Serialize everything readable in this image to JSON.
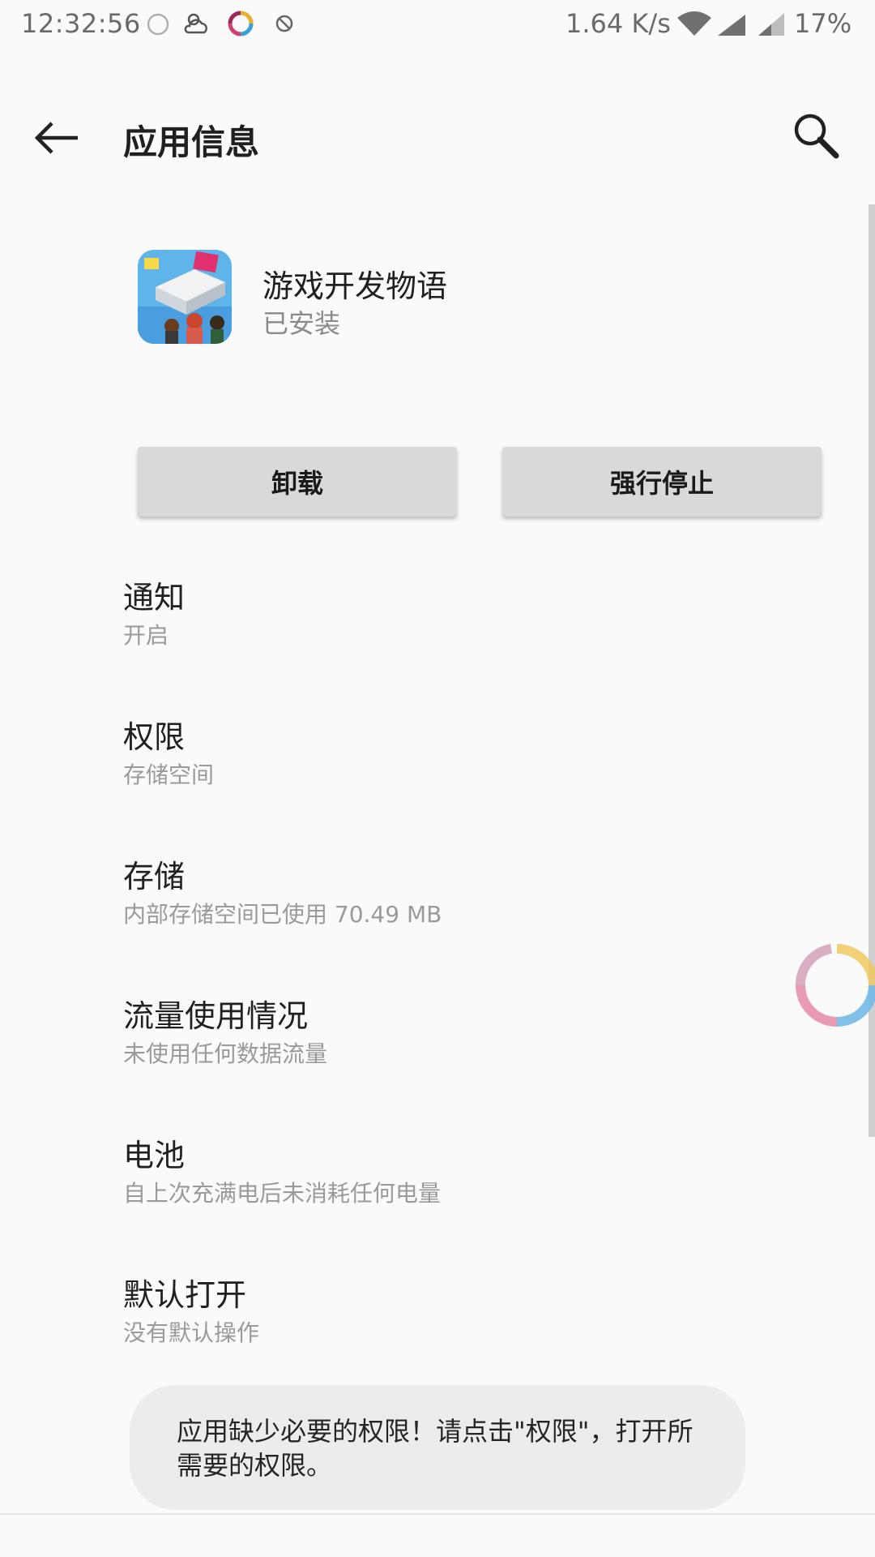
{
  "status_bar": {
    "time": "12:32:56",
    "net_speed": "1.64 K/s",
    "battery": "17%",
    "icons": [
      "alarm-icon",
      "weather-icon",
      "app-ring-icon",
      "dnd-icon",
      "wifi-icon",
      "signal-icon",
      "signal-icon-2"
    ]
  },
  "app_bar": {
    "title": "应用信息",
    "back_icon": "arrow-left-icon",
    "search_icon": "search-icon"
  },
  "app": {
    "name": "游戏开发物语",
    "status": "已安装"
  },
  "buttons": {
    "uninstall": "卸载",
    "force_stop": "强行停止"
  },
  "settings": [
    {
      "title": "通知",
      "subtitle": "开启"
    },
    {
      "title": "权限",
      "subtitle": "存储空间"
    },
    {
      "title": "存储",
      "subtitle": "内部存储空间已使用 70.49 MB"
    },
    {
      "title": "流量使用情况",
      "subtitle": "未使用任何数据流量"
    },
    {
      "title": "电池",
      "subtitle": "自上次充满电后未消耗任何电量"
    },
    {
      "title": "默认打开",
      "subtitle": "没有默认操作"
    }
  ],
  "toast": {
    "message": "应用缺少必要的权限！请点击\"权限\"，打开所需要的权限。"
  },
  "colors": {
    "background": "#fafafa",
    "button": "#d9d9d9",
    "toast": "#ececec",
    "secondary_text": "#9a9a9a"
  }
}
